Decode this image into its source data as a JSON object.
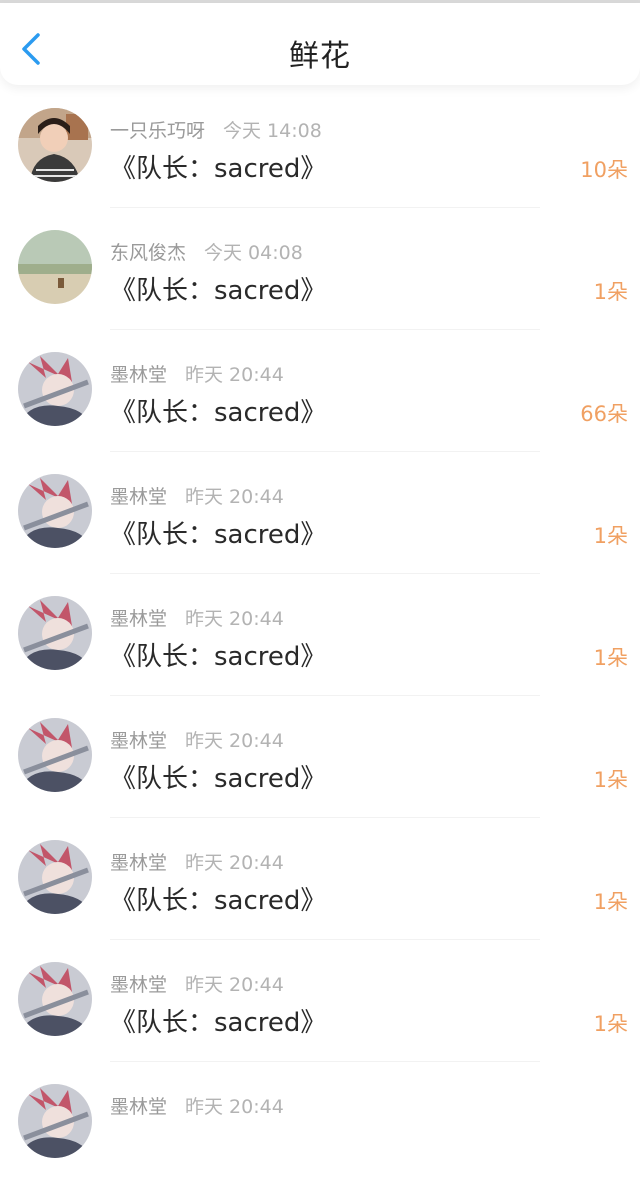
{
  "header": {
    "title": "鲜花",
    "back_icon": "chevron-left-icon",
    "accent": "#2b9bf0"
  },
  "colors": {
    "count": "#f0a062"
  },
  "records": [
    {
      "name": "一只乐巧呀",
      "time": "今天 14:08",
      "content": "《队长：sacred》",
      "count": "10朵",
      "avatar": "photo-woman"
    },
    {
      "name": "东风俊杰",
      "time": "今天 04:08",
      "content": "《队长：sacred》",
      "count": "1朵",
      "avatar": "landscape"
    },
    {
      "name": "墨林堂",
      "time": "昨天 20:44",
      "content": "《队长：sacred》",
      "count": "66朵",
      "avatar": "anime"
    },
    {
      "name": "墨林堂",
      "time": "昨天 20:44",
      "content": "《队长：sacred》",
      "count": "1朵",
      "avatar": "anime"
    },
    {
      "name": "墨林堂",
      "time": "昨天 20:44",
      "content": "《队长：sacred》",
      "count": "1朵",
      "avatar": "anime"
    },
    {
      "name": "墨林堂",
      "time": "昨天 20:44",
      "content": "《队长：sacred》",
      "count": "1朵",
      "avatar": "anime"
    },
    {
      "name": "墨林堂",
      "time": "昨天 20:44",
      "content": "《队长：sacred》",
      "count": "1朵",
      "avatar": "anime"
    },
    {
      "name": "墨林堂",
      "time": "昨天 20:44",
      "content": "《队长：sacred》",
      "count": "1朵",
      "avatar": "anime"
    },
    {
      "name": "墨林堂",
      "time": "昨天 20:44",
      "content": "",
      "count": "",
      "avatar": "anime"
    }
  ]
}
